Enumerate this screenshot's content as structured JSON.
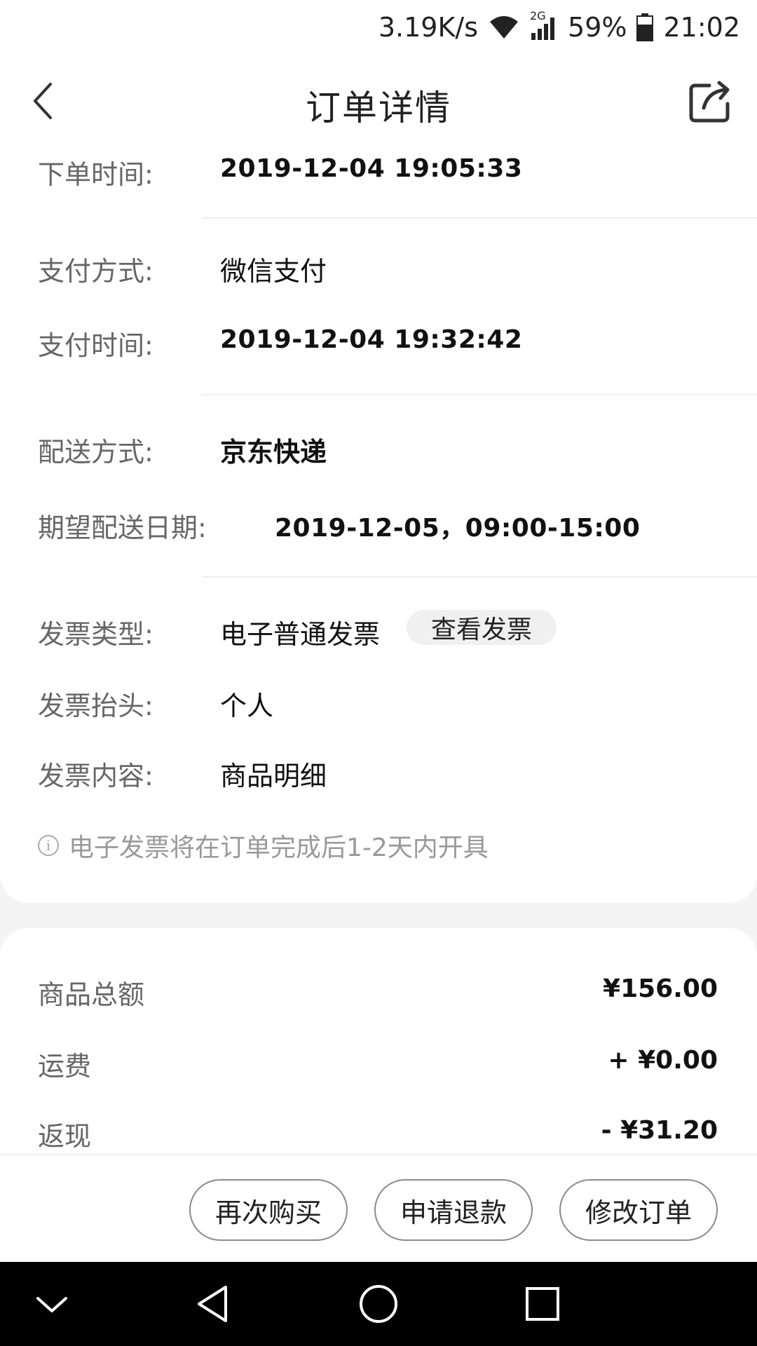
{
  "status_bar": {
    "net_speed": "3.19K/s",
    "network_type": "2G",
    "battery": "59%",
    "time": "21:02",
    "icons": [
      "wifi-icon",
      "signal-icon",
      "battery-icon"
    ]
  },
  "nav": {
    "title": "订单详情",
    "back_icon": "back-arrow-icon",
    "share_icon": "share-icon"
  },
  "order_info": {
    "order_time": {
      "label": "下单时间:",
      "value": "2019-12-04 19:05:33"
    },
    "pay_method": {
      "label": "支付方式:",
      "value": "微信支付"
    },
    "pay_time": {
      "label": "支付时间:",
      "value": "2019-12-04 19:32:42"
    },
    "delivery_method": {
      "label": "配送方式:",
      "value": "京东快递"
    },
    "expected_date": {
      "label": "期望配送日期:",
      "value": "2019-12-05，09:00-15:00"
    },
    "invoice_type": {
      "label": "发票类型:",
      "value": "电子普通发票",
      "button": "查看发票"
    },
    "invoice_title": {
      "label": "发票抬头:",
      "value": "个人"
    },
    "invoice_content": {
      "label": "发票内容:",
      "value": "商品明细"
    },
    "note": "电子发票将在订单完成后1-2天内开具"
  },
  "summary": {
    "goods_total": {
      "label": "商品总额",
      "value": "¥156.00"
    },
    "shipping": {
      "label": "运费",
      "value": "+ ¥0.00"
    },
    "cashback": {
      "label": "返现",
      "value": "- ¥31.20"
    }
  },
  "actions": {
    "rebuy": "再次购买",
    "refund": "申请退款",
    "modify": "修改订单"
  },
  "colors": {
    "page_bg": "#f3f4f3",
    "card_bg": "#ffffff",
    "label_text": "#666666",
    "value_text": "#111111",
    "system_nav_bg": "#000000"
  }
}
